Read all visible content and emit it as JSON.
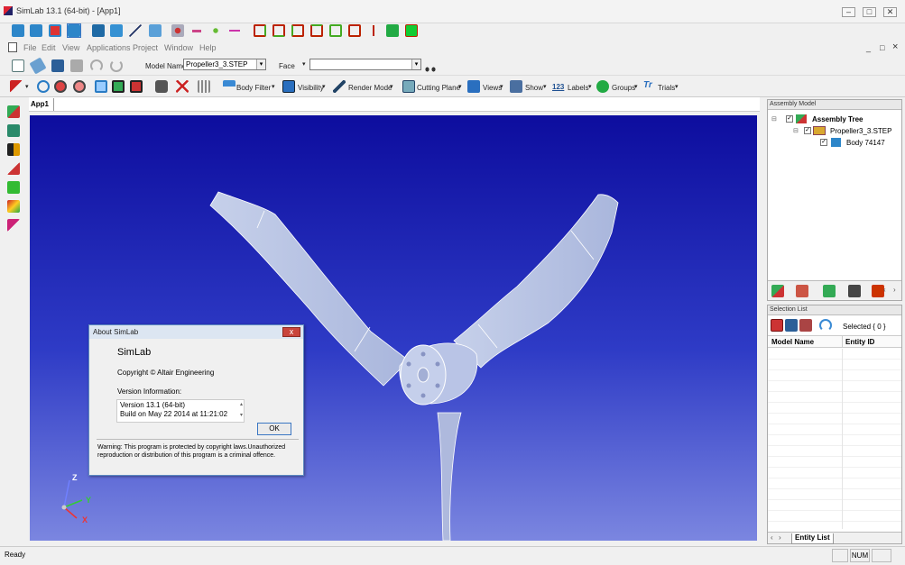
{
  "window": {
    "title": "SimLab 13.1 (64-bit) - [App1]",
    "minimize": "–",
    "restore": "□",
    "close": "✕"
  },
  "menu": [
    "File",
    "Edit",
    "View",
    "Applications",
    "Project",
    "Window",
    "Help"
  ],
  "mdi": {
    "minimize": "_",
    "restore": "□",
    "close": "×"
  },
  "toolbar3": {
    "model_name_label": "Model Name",
    "model_name_value": "Propeller3_3.STEP",
    "face_label": "Face",
    "face_value": ""
  },
  "toolbar4": {
    "body_filter": "Body Filter",
    "visibility": "Visibility",
    "render_mode": "Render Mode",
    "cutting_plane": "Cutting Plane",
    "views": "Views",
    "show": "Show",
    "labels_prefix": "123",
    "labels": "Labels",
    "groups": "Groups",
    "trials": "Trials"
  },
  "document_tab": "App1",
  "about": {
    "title": "About SimLab",
    "close": "x",
    "product": "SimLab",
    "copyright": "Copyright © Altair Engineering",
    "version_label": "Version Information:",
    "version_line1": "Version 13.1 (64-bit)",
    "version_line2": "Build on May 22 2014 at 11:21:02",
    "ok": "OK",
    "warning": "Warning: This program is protected by copyright laws.Unauthorized reproduction or distribution of this program is a criminal offence."
  },
  "triad": {
    "z": "Z",
    "y": "Y",
    "x": "X"
  },
  "assembly_panel": {
    "header": "Assembly Model",
    "tree": [
      {
        "label": "Assembly Tree",
        "bold": true
      },
      {
        "label": "Propeller3_3.STEP",
        "bold": false
      },
      {
        "label": "Body 74147",
        "bold": false
      }
    ]
  },
  "selection_panel": {
    "header": "Selection List",
    "selected": "Selected { 0 }",
    "columns": [
      "Model Name",
      "Entity ID"
    ],
    "tab": "Entity List"
  },
  "status": {
    "text": "Ready",
    "num": "NUM"
  },
  "colors": {
    "viewport_top": "#0d0d9e",
    "viewport_bottom": "#7b86e0",
    "propeller": "#c9d4ec",
    "accent": "#3a76c3"
  }
}
